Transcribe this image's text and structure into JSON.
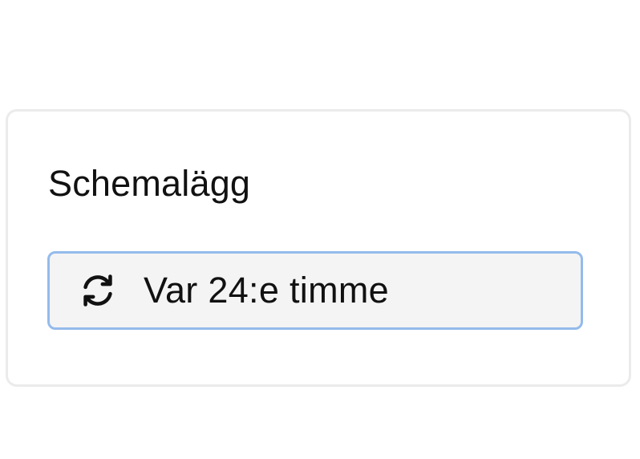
{
  "schedule": {
    "title": "Schemalägg",
    "selected_label": "Var 24:e timme",
    "selected_icon": "refresh-icon"
  },
  "colors": {
    "card_border": "#ebebeb",
    "select_border": "#94bbeb",
    "select_background": "#f4f4f4",
    "text": "#111111"
  }
}
